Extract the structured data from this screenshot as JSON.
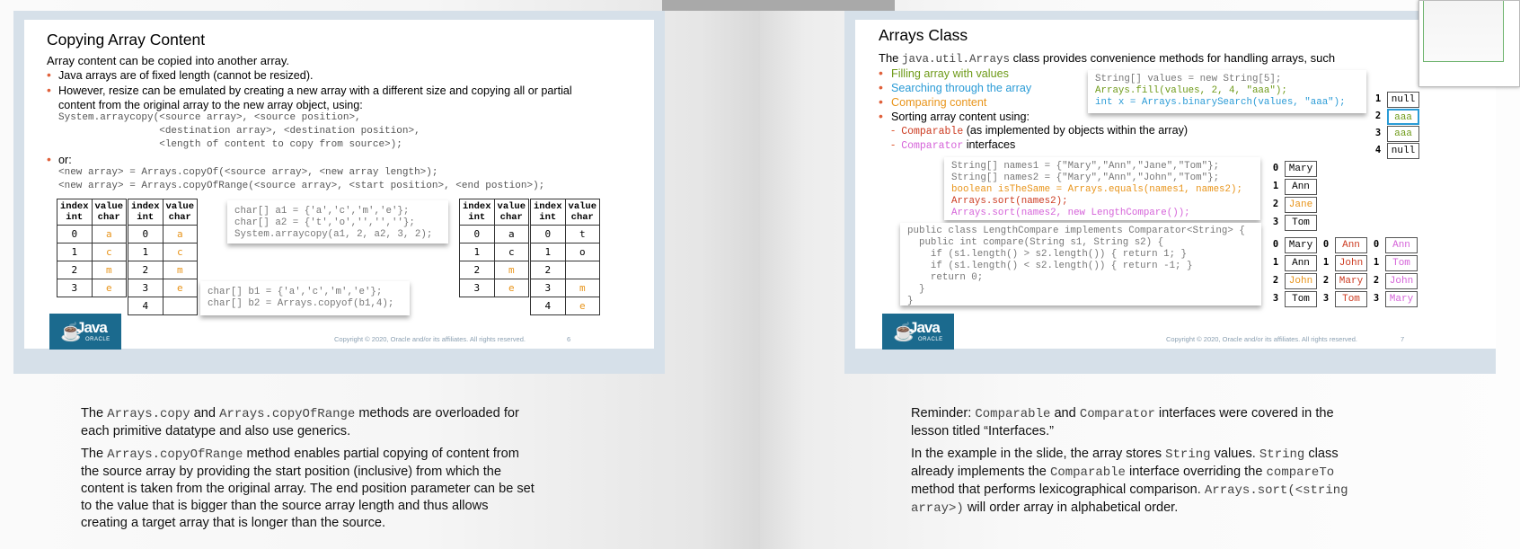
{
  "left_slide": {
    "title": "Copying Array Content",
    "intro": "Array content can be copied into another array.",
    "bullets": [
      "Java arrays are of fixed length (cannot be resized).",
      "However, resize can be emulated by creating a new array with a different size and copying all or partial",
      "content from the original array to the new array object, using:"
    ],
    "arraycopy_lines": [
      "System.arraycopy(<source array>, <source position>,",
      "                 <destination array>, <destination position>,",
      "                 <length of content to copy from source>);"
    ],
    "or_label": "or:",
    "copyof_lines": [
      "<new array> = Arrays.copyOf(<source array>, <new array length>);",
      "<new array> = Arrays.copyOfRange(<source array>, <start position>, <end postion>);"
    ],
    "table_header": [
      "index\nint",
      "value\nchar"
    ],
    "code1": "char[] a1 = {'a','c','m','e'};\nchar[] a2 = {'t','o','','',''};\nSystem.arraycopy(a1, 2, a2, 3, 2);",
    "code2": "char[] b1 = {'a','c','m','e'};\nchar[] b2 = Arrays.copyof(b1,4);",
    "t1": [
      [
        "0",
        "a"
      ],
      [
        "1",
        "c"
      ],
      [
        "2",
        "m"
      ],
      [
        "3",
        "e"
      ]
    ],
    "t2": [
      [
        "0",
        "a"
      ],
      [
        "1",
        "c"
      ],
      [
        "2",
        "m"
      ],
      [
        "3",
        "e"
      ],
      [
        "4",
        ""
      ]
    ],
    "t3": [
      [
        "0",
        "a"
      ],
      [
        "1",
        "c"
      ],
      [
        "2",
        "m"
      ],
      [
        "3",
        "e"
      ]
    ],
    "t4": [
      [
        "0",
        "t"
      ],
      [
        "1",
        "o"
      ],
      [
        "2",
        ""
      ],
      [
        "3",
        "m"
      ],
      [
        "4",
        "e"
      ]
    ],
    "copyright": "Copyright © 2020, Oracle and/or its affiliates. All rights reserved.",
    "page_number": "6"
  },
  "right_slide": {
    "title": "Arrays Class",
    "intro_pre": "The ",
    "intro_mono": "java.util.Arrays",
    "intro_post": " class provides convenience methods for handling arrays, such",
    "bullets": [
      "Filling array with values",
      "Searching through the array",
      "Comparing content",
      "Sorting array content using:"
    ],
    "sub1_mono": "Comparable",
    "sub1_text": " (as implemented by objects within the array)",
    "sub2_mono": "Comparator",
    "sub2_text": " interfaces",
    "code_fill": [
      "String[] values = new String[5];",
      "Arrays.fill(values, 2, 4, \"aaa\");",
      "int x = Arrays.binarySearch(values, \"aaa\");"
    ],
    "code_names": [
      "String[] names1 = {\"Mary\",\"Ann\",\"Jane\",\"Tom\"};",
      "String[] names2 = {\"Mary\",\"Ann\",\"John\",\"Tom\"};",
      "boolean isTheSame = Arrays.equals(names1, names2);",
      "Arrays.sort(names2);",
      "Arrays.sort(names2, new LengthCompare());"
    ],
    "code_class": [
      "public class LengthCompare implements Comparator<String> {",
      "  public int compare(String s1, String s2) {",
      "    if (s1.length() > s2.length()) { return 1; }",
      "    if (s1.length() < s2.length()) { return -1; }",
      "    return 0;",
      "  }",
      "}"
    ],
    "values_array": [
      [
        "1",
        "null"
      ],
      [
        "2",
        "aaa"
      ],
      [
        "3",
        "aaa"
      ],
      [
        "4",
        "null"
      ]
    ],
    "names1_array": [
      [
        "0",
        "Mary"
      ],
      [
        "1",
        "Ann"
      ],
      [
        "2",
        "Jane"
      ],
      [
        "3",
        "Tom"
      ]
    ],
    "sorted_a": [
      [
        "0",
        "Mary"
      ],
      [
        "1",
        "Ann"
      ],
      [
        "2",
        "John"
      ],
      [
        "3",
        "Tom"
      ]
    ],
    "sorted_b": [
      [
        "0",
        "Ann"
      ],
      [
        "1",
        "John"
      ],
      [
        "2",
        "Mary"
      ],
      [
        "3",
        "Tom"
      ]
    ],
    "sorted_c": [
      [
        "0",
        "Ann"
      ],
      [
        "1",
        "Tom"
      ],
      [
        "2",
        "John"
      ],
      [
        "3",
        "Mary"
      ]
    ],
    "copyright": "Copyright © 2020, Oracle and/or its affiliates. All rights reserved.",
    "page_number": "7"
  },
  "logo": {
    "brand": "Java",
    "sub": "ORACLE"
  },
  "left_notes": {
    "p1_a": "The ",
    "p1_m1": "Arrays.copy",
    "p1_b": " and ",
    "p1_m2": "Arrays.copyOfRange",
    "p1_c": " methods are overloaded for",
    "p1_line2": "each primitive datatype and also use generics.",
    "p2_a": "The ",
    "p2_m": "Arrays.copyOfRange",
    "p2_b": " method enables partial copying of content from",
    "p2_lines": [
      "the source array by providing the start position (inclusive) from which the",
      "content is taken from the original array. The end position parameter can be set",
      "to the value that is bigger than the source array length and thus allows",
      "creating a target array that is longer than the source."
    ]
  },
  "right_notes": {
    "p1_a": "Reminder: ",
    "p1_m1": "Comparable",
    "p1_b": " and ",
    "p1_m2": "Comparator",
    "p1_c": " interfaces were covered in the",
    "p1_line2": "lesson titled “Interfaces.”",
    "p2_a": "In the example in the slide, the array stores ",
    "p2_m1": "String",
    "p2_b": " values. ",
    "p2_m2": "String",
    "p2_c": " class",
    "p2_l2a": "already implements the ",
    "p2_l2m1": "Comparable",
    "p2_l2b": " interface overriding the ",
    "p2_l2m2": "compareTo",
    "p2_l3a": "method that performs lexicographical comparison. ",
    "p2_l3m": "Arrays.sort(<string",
    "p2_l4m": "array>)",
    "p2_l4b": "  will order array in alphabetical order."
  }
}
